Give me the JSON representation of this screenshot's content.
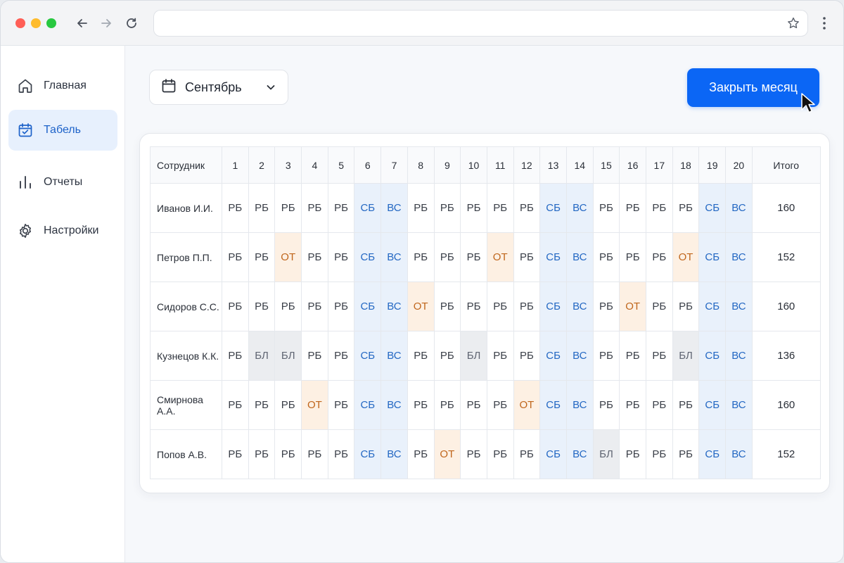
{
  "browser": {
    "url": "",
    "icons": [
      "arrow-left-icon",
      "arrow-right-icon",
      "reload-icon",
      "star-icon",
      "more-vertical-icon"
    ]
  },
  "colors": {
    "accent": "#0b66f5",
    "weekend_bg": "#e9f1fb",
    "weekend_text": "#2468c3",
    "vacation_bg": "#fdf0e3",
    "vacation_text": "#c0661c",
    "sick_bg": "#ebedf0"
  },
  "sidebar": {
    "items": [
      {
        "label": "Главная",
        "icon": "home-icon",
        "active": false
      },
      {
        "label": "Табель",
        "icon": "calendar-check-icon",
        "active": true
      },
      {
        "label": "Отчеты",
        "icon": "bar-chart-icon",
        "active": false
      },
      {
        "label": "Настройки",
        "icon": "gear-icon",
        "active": false
      }
    ]
  },
  "toolbar": {
    "month_label": "Сентябрь",
    "close_month_label": "Закрыть месяц"
  },
  "table": {
    "employee_header": "Сотрудник",
    "total_header": "Итого",
    "days": [
      "1",
      "2",
      "3",
      "4",
      "5",
      "6",
      "7",
      "8",
      "9",
      "10",
      "11",
      "12",
      "13",
      "14",
      "15",
      "16",
      "17",
      "18",
      "19",
      "20"
    ],
    "rows": [
      {
        "name": "Иванов И.И.",
        "total": "160",
        "cells": [
          "РБ",
          "РБ",
          "РБ",
          "РБ",
          "РБ",
          "СБ",
          "ВС",
          "РБ",
          "РБ",
          "РБ",
          "РБ",
          "РБ",
          "СБ",
          "ВС",
          "РБ",
          "РБ",
          "РБ",
          "РБ",
          "СБ",
          "ВС"
        ]
      },
      {
        "name": "Петров П.П.",
        "total": "152",
        "cells": [
          "РБ",
          "РБ",
          "ОТ",
          "РБ",
          "РБ",
          "СБ",
          "ВС",
          "РБ",
          "РБ",
          "РБ",
          "ОТ",
          "РБ",
          "СБ",
          "ВС",
          "РБ",
          "РБ",
          "РБ",
          "ОТ",
          "СБ",
          "ВС"
        ]
      },
      {
        "name": "Сидоров С.С.",
        "total": "160",
        "cells": [
          "РБ",
          "РБ",
          "РБ",
          "РБ",
          "РБ",
          "СБ",
          "ВС",
          "ОТ",
          "РБ",
          "РБ",
          "РБ",
          "РБ",
          "СБ",
          "ВС",
          "РБ",
          "ОТ",
          "РБ",
          "РБ",
          "СБ",
          "ВС"
        ]
      },
      {
        "name": "Кузнецов К.К.",
        "total": "136",
        "cells": [
          "РБ",
          "БЛ",
          "БЛ",
          "РБ",
          "РБ",
          "СБ",
          "ВС",
          "РБ",
          "РБ",
          "БЛ",
          "РБ",
          "РБ",
          "СБ",
          "ВС",
          "РБ",
          "РБ",
          "РБ",
          "БЛ",
          "СБ",
          "ВС"
        ]
      },
      {
        "name": "Смирнова А.А.",
        "total": "160",
        "cells": [
          "РБ",
          "РБ",
          "РБ",
          "ОТ",
          "РБ",
          "СБ",
          "ВС",
          "РБ",
          "РБ",
          "РБ",
          "РБ",
          "ОТ",
          "СБ",
          "ВС",
          "РБ",
          "РБ",
          "РБ",
          "РБ",
          "СБ",
          "ВС"
        ]
      },
      {
        "name": "Попов А.В.",
        "total": "152",
        "cells": [
          "РБ",
          "РБ",
          "РБ",
          "РБ",
          "РБ",
          "СБ",
          "ВС",
          "РБ",
          "ОТ",
          "РБ",
          "РБ",
          "РБ",
          "СБ",
          "ВС",
          "БЛ",
          "РБ",
          "РБ",
          "РБ",
          "СБ",
          "ВС"
        ]
      }
    ]
  }
}
